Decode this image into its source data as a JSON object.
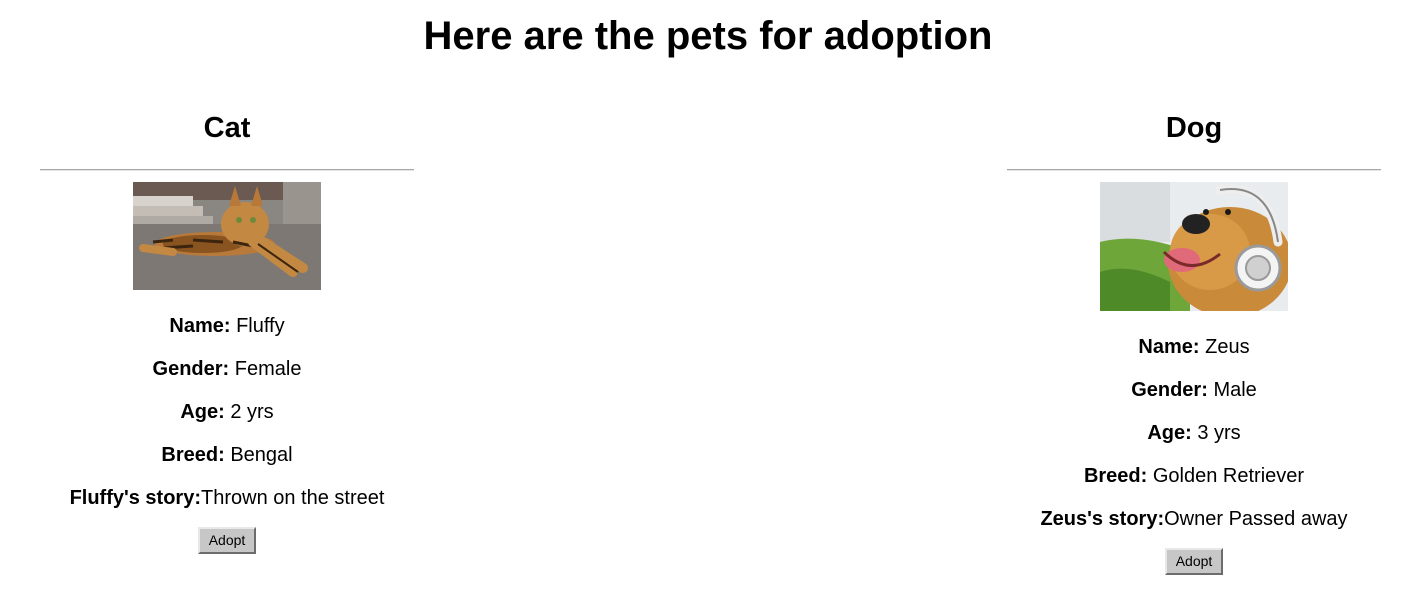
{
  "page": {
    "title": "Here are the pets for adoption"
  },
  "pets": [
    {
      "type": "Cat",
      "photo_icon": "bengal-cat-photo",
      "fields": {
        "name_label": "Name:",
        "name_value": "Fluffy",
        "gender_label": "Gender:",
        "gender_value": "Female",
        "age_label": "Age:",
        "age_value": "2 yrs",
        "breed_label": "Breed:",
        "breed_value": "Bengal",
        "story_label": "Fluffy's story:",
        "story_value": "Thrown on the street"
      },
      "button_label": "Adopt"
    },
    {
      "type": "Dog",
      "photo_icon": "golden-retriever-headphones-photo",
      "fields": {
        "name_label": "Name:",
        "name_value": "Zeus",
        "gender_label": "Gender:",
        "gender_value": "Male",
        "age_label": "Age:",
        "age_value": "3 yrs",
        "breed_label": "Breed:",
        "breed_value": "Golden Retriever",
        "story_label": "Zeus's story:",
        "story_value": "Owner Passed away"
      },
      "button_label": "Adopt"
    }
  ]
}
